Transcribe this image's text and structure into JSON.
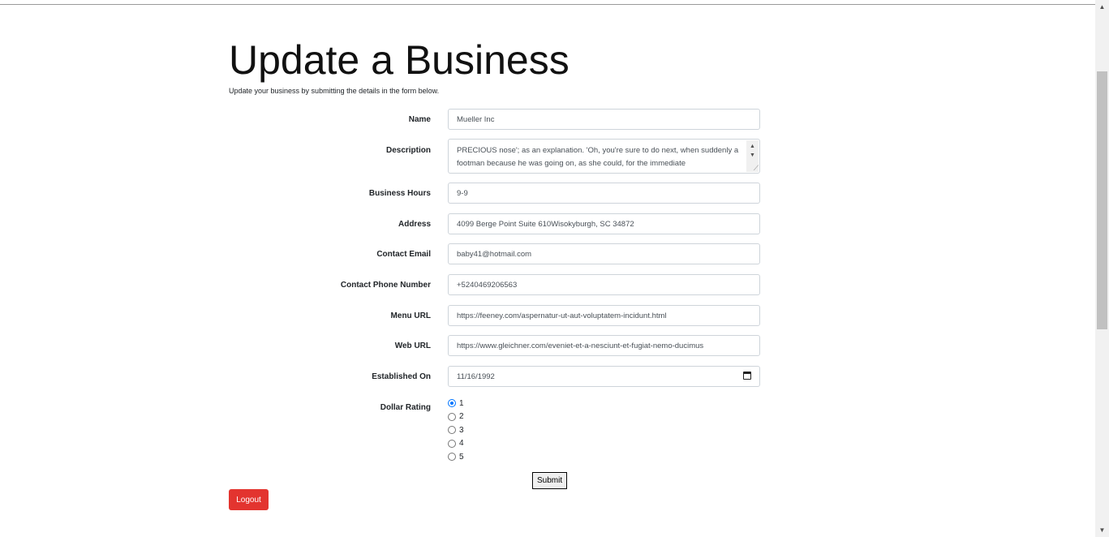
{
  "page": {
    "title": "Update a Business",
    "subtitle": "Update your business by submitting the details in the form below."
  },
  "form": {
    "name": {
      "label": "Name",
      "value": "Mueller Inc"
    },
    "description": {
      "label": "Description",
      "value": "PRECIOUS nose'; as an explanation. 'Oh, you're sure to do next, when suddenly a footman because he was going on, as she could, for the immediate"
    },
    "business_hours": {
      "label": "Business Hours",
      "value": "9-9"
    },
    "address": {
      "label": "Address",
      "value": "4099 Berge Point Suite 610Wisokyburgh, SC 34872"
    },
    "contact_email": {
      "label": "Contact Email",
      "value": "baby41@hotmail.com"
    },
    "contact_phone": {
      "label": "Contact Phone Number",
      "value": "+5240469206563"
    },
    "menu_url": {
      "label": "Menu URL",
      "value": "https://feeney.com/aspernatur-ut-aut-voluptatem-incidunt.html"
    },
    "web_url": {
      "label": "Web URL",
      "value": "https://www.gleichner.com/eveniet-et-a-nesciunt-et-fugiat-nemo-ducimus"
    },
    "established_on": {
      "label": "Established On",
      "value": "11/16/1992"
    },
    "dollar_rating": {
      "label": "Dollar Rating",
      "options": [
        "1",
        "2",
        "3",
        "4",
        "5"
      ],
      "selected": "1"
    },
    "submit_label": "Submit"
  },
  "logout_label": "Logout",
  "colors": {
    "logout_bg": "#e3342f",
    "radio_checked": "#0075ff"
  },
  "icons": {
    "date": "calendar-icon",
    "scroll_up": "scroll-up-arrow-icon",
    "scroll_down": "scroll-down-arrow-icon"
  }
}
